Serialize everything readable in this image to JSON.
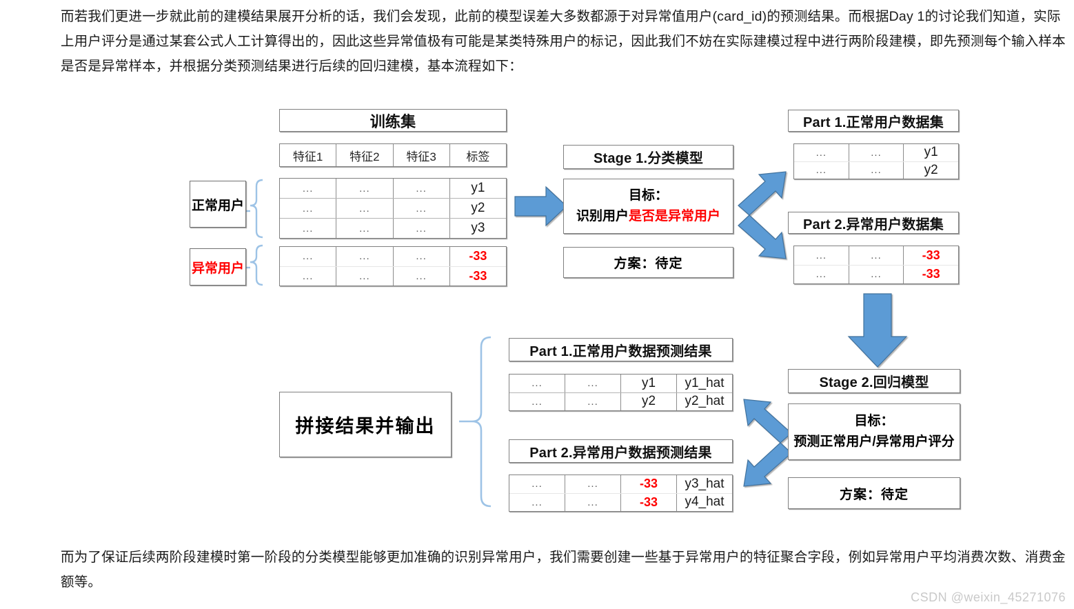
{
  "intro_paragraph": "而若我们更进一步就此前的建模结果展开分析的话，我们会发现，此前的模型误差大多数都源于对异常值用户(card_id)的预测结果。而根据Day 1的讨论我们知道，实际上用户评分是通过某套公式人工计算得出的，因此这些异常值极有可能是某类特殊用户的标记，因此我们不妨在实际建模过程中进行两阶段建模，即先预测每个输入样本是否是异常样本，并根据分类预测结果进行后续的回归建模，基本流程如下：",
  "closing_paragraph": "而为了保证后续两阶段建模时第一阶段的分类模型能够更加准确的识别异常用户，我们需要创建一些基于异常用户的特征聚合字段，例如异常用户平均消费次数、消费金额等。",
  "watermark": "CSDN @weixin_45271076",
  "colors": {
    "arrow_blue": "#5B9BD5",
    "arrow_blue_stroke": "#41719C",
    "bracket_blue": "#9DC3E6",
    "alert_red": "#FF0000",
    "border_gray": "#808080"
  },
  "diagram": {
    "train_set": {
      "title": "训练集",
      "columns": [
        "特征1",
        "特征2",
        "特征3",
        "标签"
      ],
      "normal_label": "正常用户",
      "abnormal_label": "异常用户",
      "normal_rows": [
        [
          "...",
          "...",
          "...",
          "y1"
        ],
        [
          "...",
          "...",
          "...",
          "y2"
        ],
        [
          "...",
          "...",
          "...",
          "y3"
        ]
      ],
      "abnormal_rows": [
        [
          "...",
          "...",
          "...",
          "-33"
        ],
        [
          "...",
          "...",
          "...",
          "-33"
        ]
      ]
    },
    "stage1": {
      "title": "Stage 1.分类模型",
      "goal_label": "目标：",
      "goal_prefix": "识别用户",
      "goal_highlight": "是否是异常用户",
      "plan": "方案：待定"
    },
    "stage2": {
      "title": "Stage 2.回归模型",
      "goal_label": "目标：",
      "goal_text": "预测正常用户/异常用户评分",
      "plan": "方案：待定"
    },
    "part1_dataset": {
      "title": "Part 1.正常用户数据集",
      "rows": [
        [
          "...",
          "...",
          "y1"
        ],
        [
          "...",
          "...",
          "y2"
        ]
      ]
    },
    "part2_dataset": {
      "title": "Part 2.异常用户数据集",
      "rows": [
        [
          "...",
          "...",
          "-33"
        ],
        [
          "...",
          "...",
          "-33"
        ]
      ]
    },
    "part1_result": {
      "title": "Part 1.正常用户数据预测结果",
      "rows": [
        [
          "...",
          "...",
          "y1",
          "y1_hat"
        ],
        [
          "...",
          "...",
          "y2",
          "y2_hat"
        ]
      ]
    },
    "part2_result": {
      "title": "Part 2.异常用户数据预测结果",
      "rows": [
        [
          "...",
          "...",
          "-33",
          "y3_hat"
        ],
        [
          "...",
          "...",
          "-33",
          "y4_hat"
        ]
      ]
    },
    "merge_output": "拼接结果并输出"
  }
}
